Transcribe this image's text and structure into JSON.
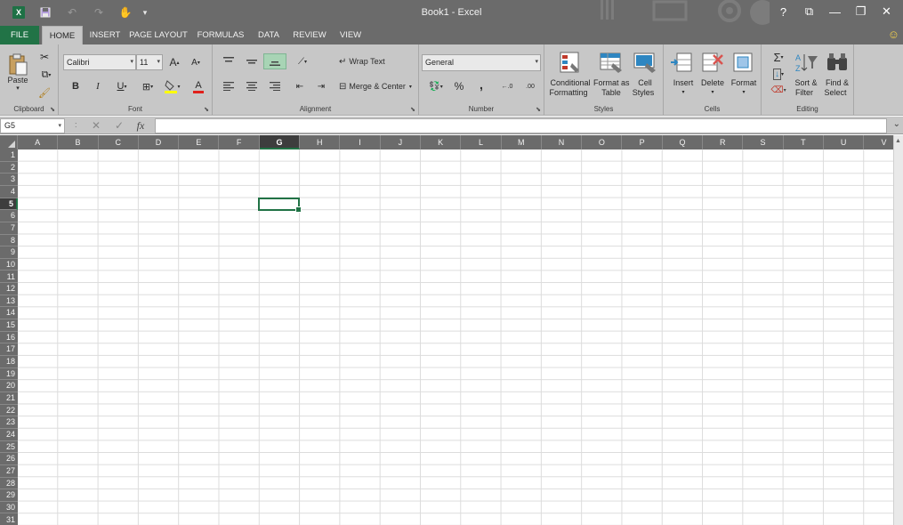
{
  "window": {
    "title": "Book1 - Excel",
    "help": "?",
    "ribbon_display": "⧉",
    "minimize": "—",
    "restore": "❐",
    "close": "✕"
  },
  "qat": {
    "app_icon": "X",
    "save": "💾",
    "undo": "↶",
    "redo": "↷",
    "touch": "✋",
    "customize": "▾"
  },
  "tabs": [
    "FILE",
    "HOME",
    "INSERT",
    "PAGE LAYOUT",
    "FORMULAS",
    "DATA",
    "REVIEW",
    "VIEW"
  ],
  "active_tab": "HOME",
  "user_icon": "☺",
  "ribbon": {
    "clipboard": {
      "label": "Clipboard",
      "paste": "Paste",
      "paste_arrow": "▾"
    },
    "font": {
      "label": "Font",
      "font_name": "Calibri",
      "font_size": "11",
      "grow": "A",
      "shrink": "A",
      "bold": "B",
      "italic": "I",
      "underline": "U",
      "font_color_letter": "A"
    },
    "alignment": {
      "label": "Alignment",
      "wrap_text": "Wrap Text",
      "merge_center": "Merge & Center"
    },
    "number": {
      "label": "Number",
      "format": "General",
      "percent": "%",
      "comma": ",",
      "inc_decimal": "←.0",
      "dec_decimal": ".00"
    },
    "styles": {
      "label": "Styles",
      "conditional_1": "Conditional",
      "conditional_2": "Formatting",
      "format_table_1": "Format as",
      "format_table_2": "Table",
      "cell_styles_1": "Cell",
      "cell_styles_2": "Styles"
    },
    "cells": {
      "label": "Cells",
      "insert": "Insert",
      "delete": "Delete",
      "format": "Format"
    },
    "editing": {
      "label": "Editing",
      "sigma": "Σ",
      "sort_1": "Sort &",
      "sort_2": "Filter",
      "find_1": "Find &",
      "find_2": "Select"
    }
  },
  "formula_bar": {
    "name_box": "G5",
    "sep": ":",
    "cancel": "✕",
    "enter": "✓",
    "fx": "fx",
    "value": "",
    "expand": "⌄"
  },
  "grid": {
    "columns": [
      "A",
      "B",
      "C",
      "D",
      "E",
      "F",
      "G",
      "H",
      "I",
      "J",
      "K",
      "L",
      "M",
      "N",
      "O",
      "P",
      "Q",
      "R",
      "S",
      "T",
      "U",
      "V"
    ],
    "rows": [
      "1",
      "2",
      "3",
      "4",
      "5",
      "6",
      "7",
      "8",
      "9",
      "10",
      "11",
      "12",
      "13",
      "14",
      "15",
      "16",
      "17",
      "18",
      "19",
      "20",
      "21",
      "22",
      "23",
      "24",
      "25",
      "26",
      "27",
      "28",
      "29",
      "30",
      "31"
    ],
    "selected_column": "G",
    "selected_row": "5"
  },
  "colors": {
    "accent": "#217346",
    "chrome": "#6b6b6b",
    "ribbon": "#c7c7c7"
  }
}
